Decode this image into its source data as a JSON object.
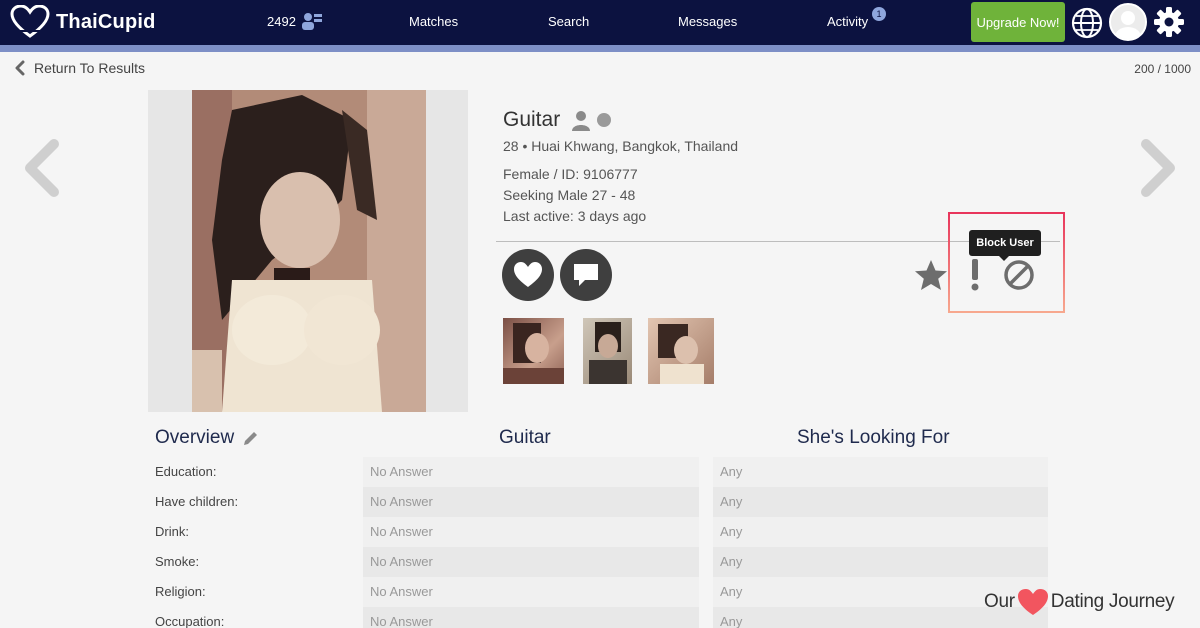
{
  "header": {
    "brand": "ThaiCupid",
    "online_count": "2492",
    "nav": [
      {
        "label": "Matches"
      },
      {
        "label": "Search"
      },
      {
        "label": "Messages"
      },
      {
        "label": "Activity"
      }
    ],
    "activity_badge": "1",
    "upgrade_label": "Upgrade Now!"
  },
  "subbar": {
    "return_label": "Return To Results",
    "page_count": "200 / 1000"
  },
  "profile": {
    "name": "Guitar",
    "location": "28 • Huai Khwang, Bangkok, Thailand",
    "gender_id": "Female / ID: 9106777",
    "seeking": "Seeking Male 27 - 48",
    "last_active": "Last active: 3 days ago",
    "tooltip": "Block User"
  },
  "table": {
    "overview_title": "Overview",
    "member_title": "Guitar",
    "looking_title": "She's Looking For",
    "rows": [
      {
        "label": "Education:",
        "value": "No Answer",
        "looking": "Any"
      },
      {
        "label": "Have children:",
        "value": "No Answer",
        "looking": "Any"
      },
      {
        "label": "Drink:",
        "value": "No Answer",
        "looking": "Any"
      },
      {
        "label": "Smoke:",
        "value": "No Answer",
        "looking": "Any"
      },
      {
        "label": "Religion:",
        "value": "No Answer",
        "looking": "Any"
      },
      {
        "label": "Occupation:",
        "value": "No Answer",
        "looking": "Any"
      }
    ]
  },
  "watermark": {
    "left": "Our",
    "right": "Dating Journey"
  },
  "colors": {
    "nav_bg": "#0c1240",
    "nav_stripe": "#7d8fc6",
    "upgrade_green": "#6fb33a",
    "highlight_pink": "#e8345b",
    "heart_red": "#f2555f"
  },
  "icons": [
    "heart-logo-icon",
    "online-users-icon",
    "globe-icon",
    "gear-icon",
    "chevron-left-icon",
    "chevron-right-icon",
    "person-icon",
    "status-dot-icon",
    "heart-icon",
    "chat-icon",
    "star-icon",
    "report-icon",
    "block-icon",
    "pencil-icon"
  ]
}
